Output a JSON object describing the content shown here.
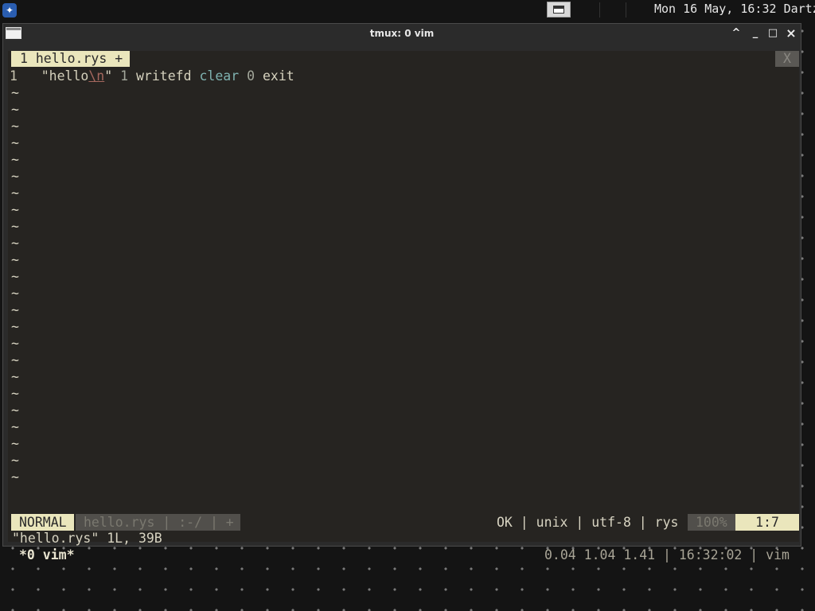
{
  "panel": {
    "logo_icon": "distro-logo-icon",
    "task_icon": "window-icon",
    "clock": "Mon 16 May, 16:32",
    "user": "Dartz"
  },
  "window": {
    "title": "tmux: 0 vim",
    "buttons": {
      "minimize_up": "^",
      "minimize": "_",
      "maximize": "□",
      "close": "×"
    }
  },
  "vim": {
    "tab": {
      "label": "1 hello.rys +",
      "close_label": "X"
    },
    "line_number": "1",
    "code": {
      "str_open": "\"hello",
      "escape": "\\n",
      "str_close": "\"",
      "num1": "1",
      "word1": "writefd",
      "word2": "clear",
      "num2": "0",
      "word3": "exit"
    },
    "tilde": "~",
    "tilde_count": 24,
    "statusline": {
      "mode": "NORMAL",
      "file_info": "hello.rys | :-/ | +",
      "right_info": "OK | unix | utf-8 | rys",
      "percent": "100%",
      "position": "1:7"
    },
    "message": "\"hello.rys\" 1L, 39B"
  },
  "tmux": {
    "window_label": "*0 vim*",
    "status_right": "0.04 1.04 1.41 | 16:32:02 | vim"
  },
  "colors": {
    "terminal_bg": "#262421",
    "accent": "#eae6bc",
    "desktop_bg": "#141414"
  }
}
